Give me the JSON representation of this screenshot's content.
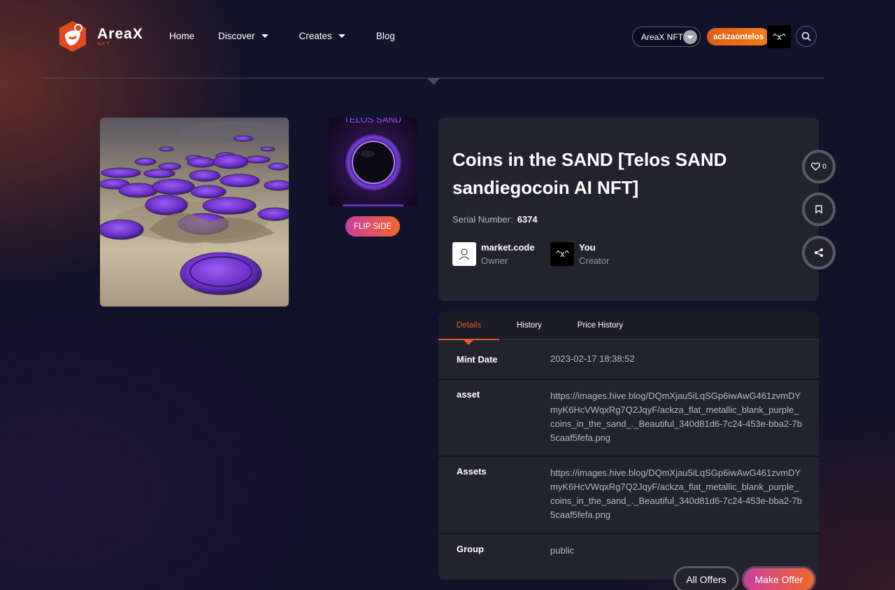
{
  "header": {
    "logo_name": "AreaX",
    "logo_sub": "NFT",
    "nav": {
      "home": "Home",
      "discover": "Discover",
      "creates": "Creates",
      "blog": "Blog"
    },
    "network_select": "AreaX NFT",
    "username": "ackzaontelos",
    "user_avatar_text": "^x^"
  },
  "media": {
    "thumb_caption": "TELOS SAND",
    "flip_label": "FLIP SIDE"
  },
  "nft": {
    "title": "Coins in the SAND [Telos SAND sandiegocoin AI NFT]",
    "serial_label": "Serial Number:",
    "serial_value": "6374",
    "owner_name": "market.code",
    "owner_role": "Owner",
    "creator_name": "You",
    "creator_role": "Creator",
    "creator_avatar_text": "^x^",
    "like_count": "0"
  },
  "tabs": {
    "details": "Details",
    "history": "History",
    "price_history": "Price History"
  },
  "details": {
    "mint_label": "Mint Date",
    "mint_value": "2023-02-17 18:38:52",
    "asset_label": "asset",
    "asset_value": "https://images.hive.blog/DQmXjau5iLqSGp6iwAwG461zvmDYmyK6HcVWqxRg7Q2JqyF/ackza_flat_metallic_blank_purple_coins_in_the_sand_._Beautiful_340d81d6-7c24-453e-bba2-7b5caaf5fefa.png",
    "assets_label": "Assets",
    "assets_value": "https://images.hive.blog/DQmXjau5iLqSGp6iwAwG461zvmDYmyK6HcVWqxRg7Q2JqyF/ackza_flat_metallic_blank_purple_coins_in_the_sand_._Beautiful_340d81d6-7c24-453e-bba2-7b5caaf5fefa.png",
    "group_label": "Group",
    "group_value": "public"
  },
  "actions": {
    "all_offers": "All Offers",
    "make_offer": "Make Offer"
  },
  "colors": {
    "accent": "#e05a2a",
    "card": "#23232f",
    "background": "#12122a"
  }
}
